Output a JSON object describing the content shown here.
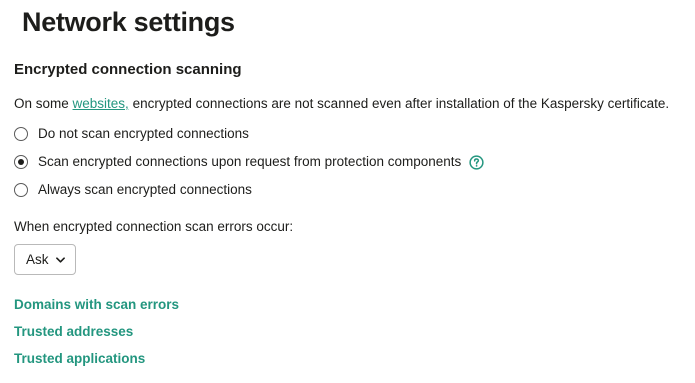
{
  "page": {
    "title": "Network settings"
  },
  "section": {
    "title": "Encrypted connection scanning",
    "info_prefix": "On some ",
    "info_link": "websites,",
    "info_suffix": " encrypted connections are not scanned even after installation of the Kaspersky certificate."
  },
  "radios": [
    {
      "label": "Do not scan encrypted connections",
      "checked": false
    },
    {
      "label": "Scan encrypted connections upon request from protection components",
      "checked": true,
      "help_icon": "question-circle-icon"
    },
    {
      "label": "Always scan encrypted connections",
      "checked": false
    }
  ],
  "errors": {
    "label": "When encrypted connection scan errors occur:",
    "select_value": "Ask"
  },
  "links": {
    "domains": "Domains with scan errors",
    "trusted_addresses": "Trusted addresses",
    "trusted_applications": "Trusted applications"
  },
  "colors": {
    "accent": "#23967f",
    "text": "#1d1d1b"
  }
}
